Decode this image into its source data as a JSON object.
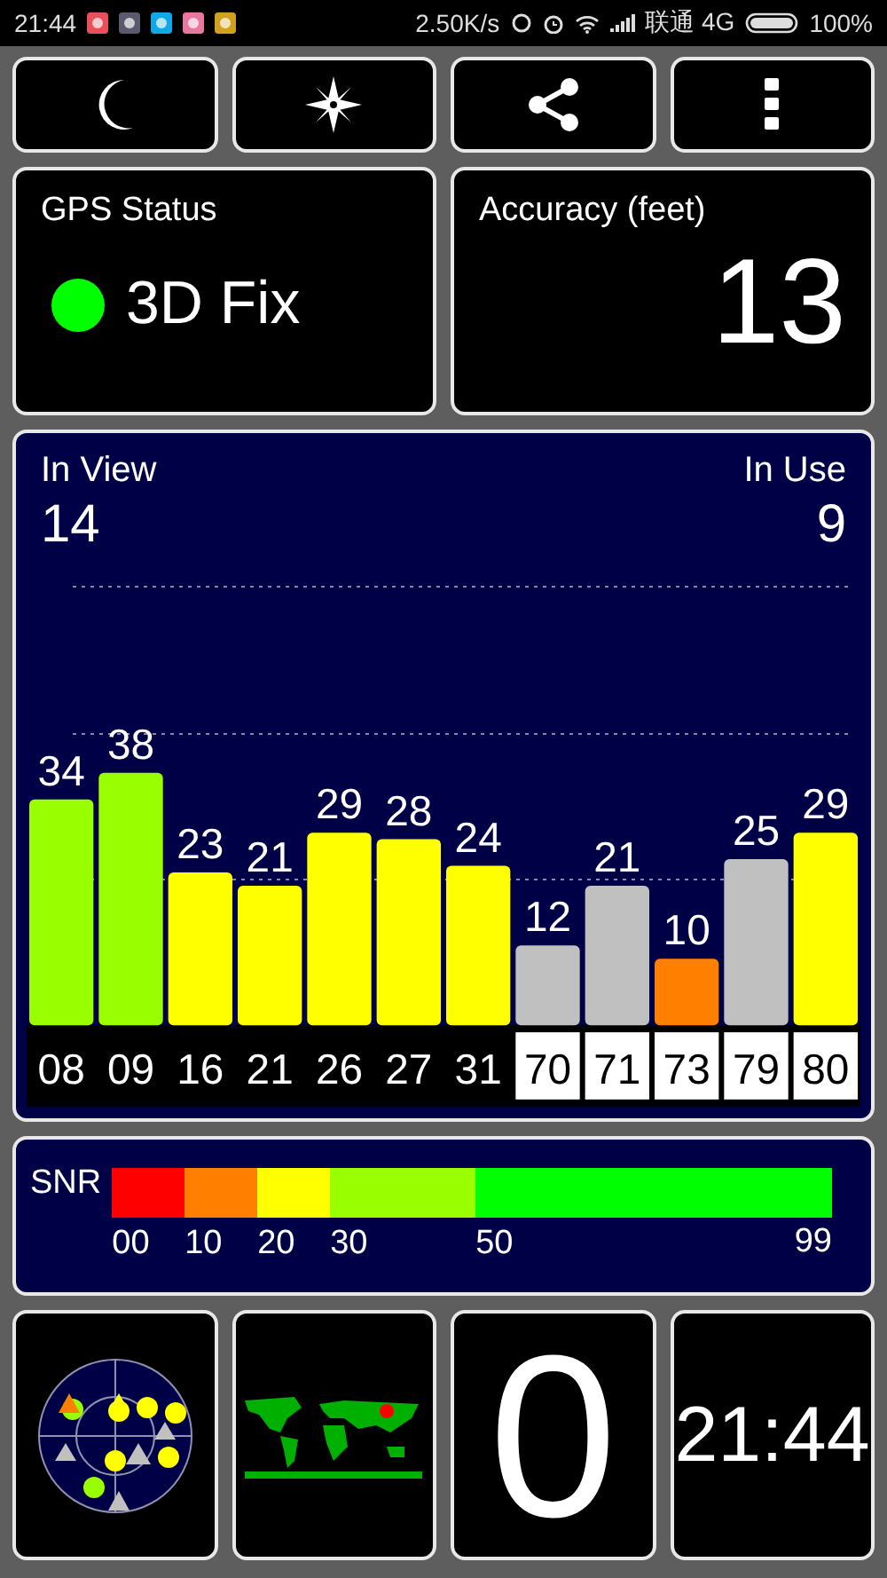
{
  "status_bar": {
    "time": "21:44",
    "speed": "2.50K/s",
    "carrier": "联通 4G",
    "battery": "100%"
  },
  "toolbar": [
    {
      "kind": "night"
    },
    {
      "kind": "compass"
    },
    {
      "kind": "share"
    },
    {
      "kind": "menu"
    }
  ],
  "gps_status": {
    "title": "GPS Status",
    "value": "3D Fix"
  },
  "accuracy": {
    "title": "Accuracy (feet)",
    "value": "13"
  },
  "satellites": {
    "in_view_label": "In View",
    "in_view": "14",
    "in_use_label": "In Use",
    "in_use": "9",
    "chart_data": {
      "type": "bar",
      "categories": [
        "08",
        "09",
        "16",
        "21",
        "26",
        "27",
        "31",
        "70",
        "71",
        "73",
        "79",
        "80"
      ],
      "values": [
        34,
        38,
        23,
        21,
        29,
        28,
        24,
        12,
        21,
        10,
        25,
        29
      ],
      "data_labels": true
    },
    "bars": [
      {
        "in_use": true,
        "kind": "gps"
      },
      {
        "in_use": true,
        "kind": "gps"
      },
      {
        "in_use": true,
        "kind": "gps"
      },
      {
        "in_use": true,
        "kind": "gps"
      },
      {
        "in_use": true,
        "kind": "gps"
      },
      {
        "in_use": true,
        "kind": "gps"
      },
      {
        "in_use": true,
        "kind": "gps"
      },
      {
        "in_use": false,
        "kind": "glonass"
      },
      {
        "in_use": false,
        "kind": "glonass"
      },
      {
        "in_use": true,
        "kind": "glonass"
      },
      {
        "in_use": false,
        "kind": "glonass"
      },
      {
        "in_use": true,
        "kind": "glonass"
      }
    ]
  },
  "snr_legend": {
    "title": "SNR",
    "segments": [
      {
        "label": "00",
        "color": "#ff0000"
      },
      {
        "label": "10",
        "color": "#ff8000"
      },
      {
        "label": "20",
        "color": "#ffff00"
      },
      {
        "label": "30",
        "color": "#99ff00"
      },
      {
        "label": "50",
        "color": "#00ff00"
      }
    ],
    "end_label": "99"
  },
  "bottom_tiles": [
    {
      "kind": "sky_plot"
    },
    {
      "kind": "world_map"
    },
    {
      "kind": "big_number",
      "value": "0"
    },
    {
      "kind": "clock",
      "value": "21:44"
    }
  ]
}
